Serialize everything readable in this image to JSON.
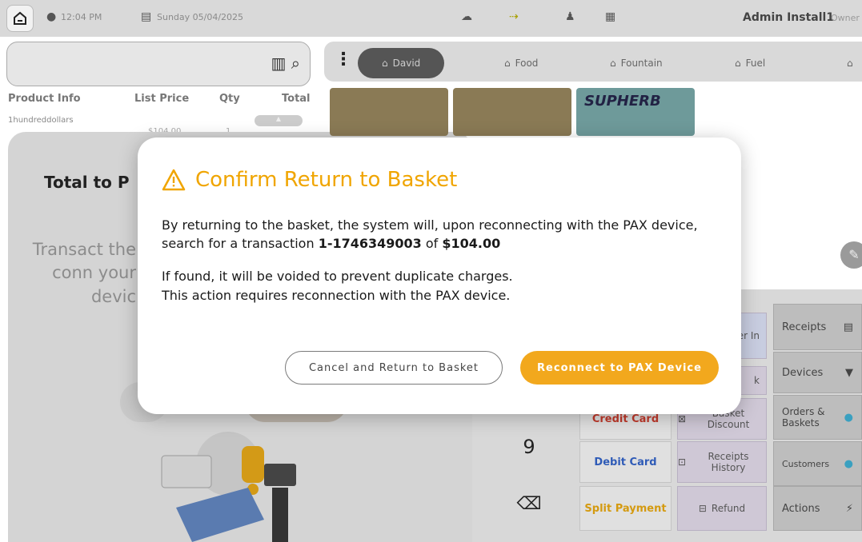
{
  "status_bar": {
    "time": "12:04 PM",
    "date": "Sunday 05/04/2025",
    "user": "Admin Install1",
    "role": "Owner"
  },
  "basket": {
    "columns": [
      "Product Info",
      "List Price",
      "Qty",
      "Total"
    ],
    "row": {
      "name": "1hundreddollars",
      "price": "$104.00",
      "qty": "1"
    }
  },
  "payment_panel": {
    "title": "Total to P",
    "message": "Transact the conn your devic"
  },
  "categories": {
    "tabs": [
      "David",
      "Food",
      "Fountain",
      "Fuel"
    ],
    "active": "David",
    "tile_label": "SUPHERB"
  },
  "keypad": {
    "key_9": "9",
    "payment_methods": [
      "Credit Card",
      "Debit Card",
      "Split Payment"
    ],
    "middle_actions": [
      "Basket Discount",
      "Receipts History",
      "Refund"
    ],
    "right_actions": [
      "Receipts",
      "Devices",
      "Orders & Baskets",
      "Customers",
      "Actions"
    ],
    "partial_labels": [
      "her In",
      "k"
    ]
  },
  "modal": {
    "title": "Confirm Return to Basket",
    "line1_prefix": "By returning to the basket, the system will, upon reconnecting with the PAX device, search for a transaction ",
    "transaction_id": "1-1746349003",
    "line1_mid": " of ",
    "amount": "$104.00",
    "line2": "If found, it will be voided to prevent duplicate charges.",
    "line3": "This action requires reconnection with the PAX device.",
    "cancel_label": "Cancel and Return to Basket",
    "confirm_label": "Reconnect to PAX Device"
  },
  "colors": {
    "accent": "#f2a81d",
    "title_orange": "#f0a500",
    "debit_blue": "#2f5bb7",
    "credit_red": "#c0392b"
  }
}
